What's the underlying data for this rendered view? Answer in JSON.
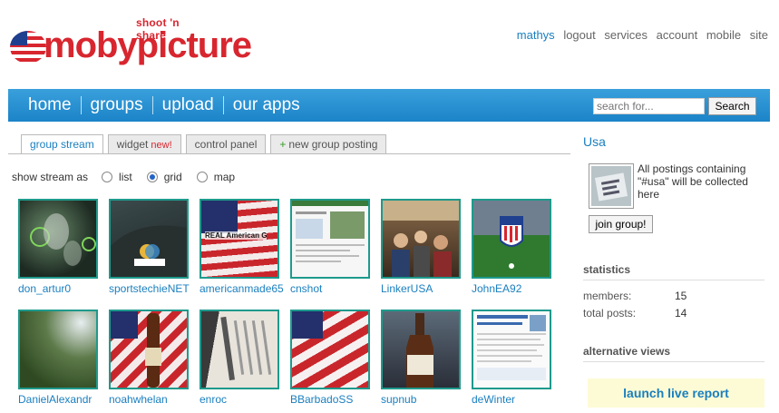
{
  "header": {
    "tagline": "shoot 'n share",
    "brand": "mobypicture",
    "top_nav": [
      {
        "label": "mathys"
      },
      {
        "label": "logout"
      },
      {
        "label": "services"
      },
      {
        "label": "account"
      },
      {
        "label": "mobile"
      },
      {
        "label": "site"
      }
    ]
  },
  "main_nav": [
    {
      "label": "home"
    },
    {
      "label": "groups"
    },
    {
      "label": "upload"
    },
    {
      "label": "our apps"
    }
  ],
  "search": {
    "placeholder": "search for...",
    "button": "Search"
  },
  "tabs": [
    {
      "label": "group stream",
      "active": true
    },
    {
      "label": "widget",
      "badge": "new!"
    },
    {
      "label": "control panel"
    },
    {
      "label": "new group posting",
      "prefix": "+"
    }
  ],
  "view_switch": {
    "label": "show stream as",
    "options": [
      {
        "label": "list",
        "checked": false
      },
      {
        "label": "grid",
        "checked": true
      },
      {
        "label": "map",
        "checked": false
      }
    ]
  },
  "grid_items": [
    {
      "user": "don_artur0"
    },
    {
      "user": "sportstechieNET"
    },
    {
      "user": "americanmade65",
      "overlay": "REAL American G"
    },
    {
      "user": "cnshot"
    },
    {
      "user": "LinkerUSA"
    },
    {
      "user": "JohnEA92"
    },
    {
      "user": "DanielAlexandr"
    },
    {
      "user": "noahwhelan"
    },
    {
      "user": "enroc"
    },
    {
      "user": "BBarbadoSS"
    },
    {
      "user": "supnub"
    },
    {
      "user": "deWinter"
    }
  ],
  "sidebar": {
    "group_name": "Usa",
    "description": "All postings containing \"#usa\" will be collected here",
    "join_button": "join group!",
    "statistics_title": "statistics",
    "stats": [
      {
        "label": "members:",
        "value": "15"
      },
      {
        "label": "total posts:",
        "value": "14"
      }
    ],
    "alt_views_title": "alternative views",
    "live_report": "launch live report"
  },
  "colors": {
    "brand_red": "#d8262f",
    "nav_blue": "#1b83c8",
    "link_blue": "#1a7fbf",
    "thumb_border": "#1e9a8c"
  }
}
